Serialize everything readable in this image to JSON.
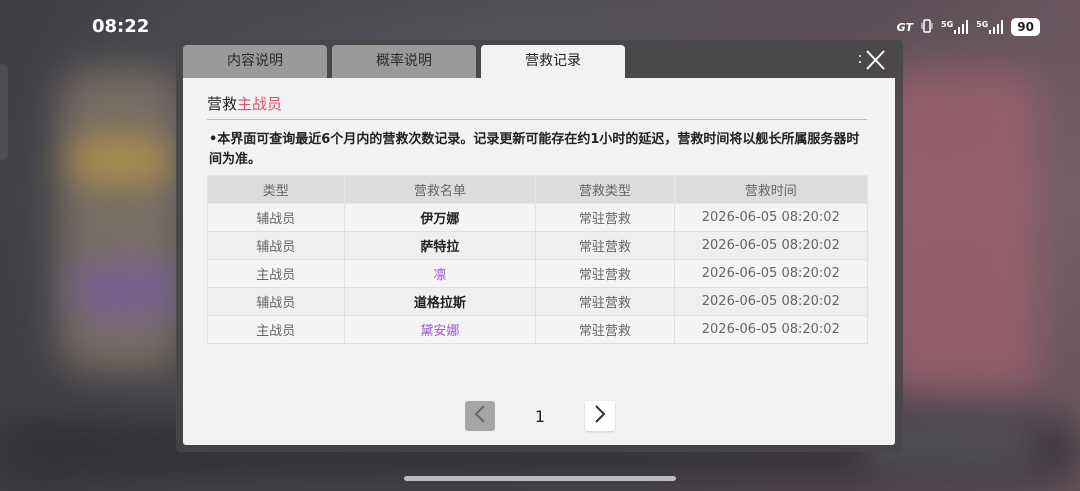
{
  "status_bar": {
    "time": "08:22",
    "carrier_badge": "GT",
    "signal_1_label": "5G",
    "signal_2_label": "5G",
    "battery": "90"
  },
  "tabs": [
    {
      "label": "内容说明",
      "active": false
    },
    {
      "label": "概率说明",
      "active": false
    },
    {
      "label": "营救记录",
      "active": true
    }
  ],
  "section": {
    "heading_prefix": "营救",
    "heading_accent": "主战员",
    "accent_color": "#e0506a"
  },
  "notice": "•本界面可查询最近6个月内的营救次数记录。记录更新可能存在约1小时的延迟，营救时间将以舰长所属服务器时间为准。",
  "table": {
    "headers": [
      "类型",
      "营救名单",
      "营救类型",
      "营救时间"
    ],
    "rows": [
      {
        "type": "辅战员",
        "name": "伊万娜",
        "rescue_type": "常驻营救",
        "time": "2026-06-05 08:20:02"
      },
      {
        "type": "辅战员",
        "name": "萨特拉",
        "rescue_type": "常驻营救",
        "time": "2026-06-05 08:20:02"
      },
      {
        "type": "主战员",
        "name": "凛",
        "rescue_type": "常驻营救",
        "time": "2026-06-05 08:20:02"
      },
      {
        "type": "辅战员",
        "name": "道格拉斯",
        "rescue_type": "常驻营救",
        "time": "2026-06-05 08:20:02"
      },
      {
        "type": "主战员",
        "name": "黛安娜",
        "rescue_type": "常驻营救",
        "time": "2026-06-05 08:20:02"
      }
    ],
    "highlight_color": "#9a5ae0"
  },
  "pagination": {
    "current_page": "1",
    "prev_icon": "chevron-left-icon",
    "next_icon": "chevron-right-icon"
  }
}
